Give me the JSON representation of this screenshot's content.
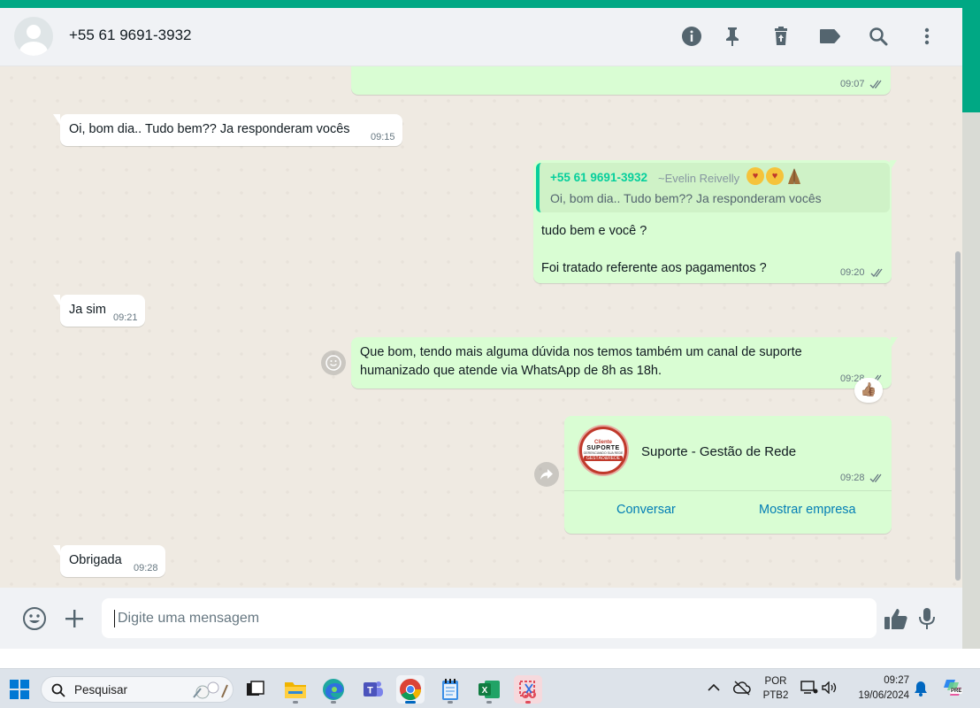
{
  "header": {
    "contact_name": "+55 61 9691-3932",
    "icons": [
      "info-icon",
      "pin-icon",
      "delete-icon",
      "label-icon",
      "search-icon",
      "more-icon"
    ]
  },
  "messages": [
    {
      "id": "m0",
      "direction": "out",
      "text": "",
      "time": "09:07",
      "status": "read"
    },
    {
      "id": "m1",
      "direction": "in",
      "text": "Oi, bom dia.. Tudo bem?? Ja responderam vocês",
      "time": "09:15"
    },
    {
      "id": "m2",
      "direction": "out",
      "quote": {
        "author": "+55 61 9691-3932",
        "pushname": "~Evelin Reivelly",
        "text": "Oi, bom dia.. Tudo bem?? Ja responderam vocês"
      },
      "line1": "tudo bem e você ?",
      "line2": "Foi tratado referente aos pagamentos ?",
      "time": "09:20",
      "status": "read"
    },
    {
      "id": "m3",
      "direction": "in",
      "text": "Ja sim",
      "time": "09:21"
    },
    {
      "id": "m4",
      "direction": "out",
      "line1": "Que bom, tendo mais alguma dúvida nos temos também um canal de suporte",
      "line2": "humanizado que atende via WhatsApp de 8h as 18h.",
      "time": "09:28",
      "status": "read",
      "reaction": "👍🏽"
    },
    {
      "id": "m5",
      "direction": "out",
      "type": "contact_card",
      "card": {
        "logo_lines": [
          "Cliente",
          "SUPORTE",
          "GERENCIANDO SUA REDE",
          "GESTÃO&REDE"
        ],
        "name": "Suporte - Gestão de Rede",
        "button_chat": "Conversar",
        "button_business": "Mostrar empresa"
      },
      "time": "09:28",
      "status": "read"
    },
    {
      "id": "m6",
      "direction": "in",
      "text": "Obrigada",
      "time": "09:28"
    }
  ],
  "composer": {
    "placeholder": "Digite uma mensagem",
    "icons": [
      "emoji-icon",
      "plus-icon",
      "thumbs-up-icon",
      "microphone-icon"
    ]
  },
  "taskbar": {
    "search_placeholder": "Pesquisar",
    "apps": [
      "task-view",
      "file-explorer",
      "edge",
      "teams",
      "chrome",
      "notepad",
      "excel",
      "snipping-tool"
    ],
    "language_top": "POR",
    "language_bottom": "PTB2",
    "time": "09:27",
    "date": "19/06/2024",
    "copilot_badge": "PRE"
  },
  "colors": {
    "accent": "#00a884",
    "outgoing_bubble": "#d9fdd3",
    "incoming_bubble": "#ffffff",
    "quote_author": "#06cf9c",
    "link": "#027eb5",
    "read_ticks": "#667781"
  }
}
